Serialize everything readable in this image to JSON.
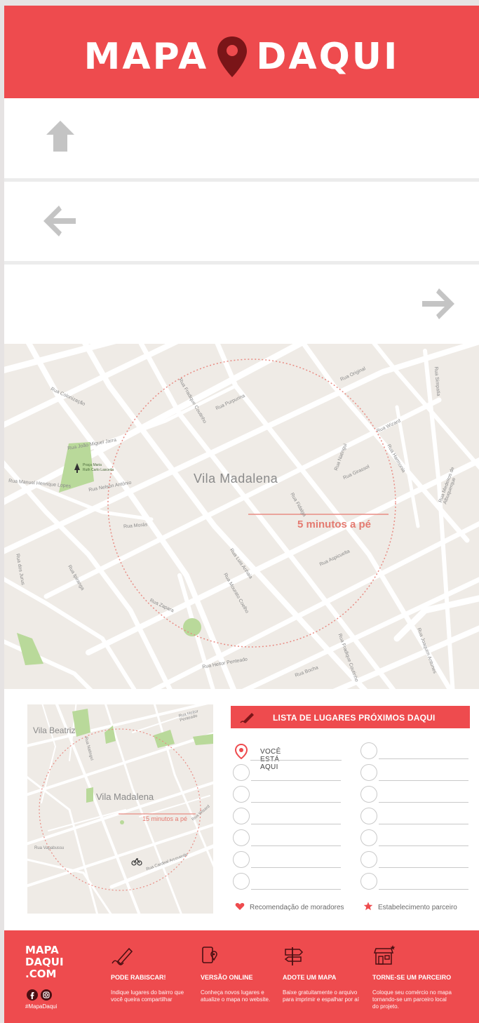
{
  "header": {
    "brand_left": "MAPA",
    "brand_right": "DAQUI"
  },
  "directions": [
    {
      "icon": "arrow-up-icon"
    },
    {
      "icon": "arrow-left-icon"
    },
    {
      "icon": "arrow-right-icon"
    }
  ],
  "main_map": {
    "neighborhood": "Vila Madalena",
    "radius_label": "5 minutos a pé",
    "park_label_1": "Praça Maria",
    "park_label_2": "Ruth Carlo Lasceda",
    "streets": [
      "Rua Purpurina",
      "Rua Girassol",
      "Rua Original",
      "Rua Wizard",
      "Rua Fradique Coutinho",
      "Rua Mourato Coelho",
      "Rua Luis Anhaia",
      "Rua Aspicuelta",
      "Rua Morás",
      "Rua Harmonia",
      "Rua Fidalga",
      "Rua Simpatia",
      "Rua Medeiros de Albuquerque",
      "Rua Natingui",
      "Rua João Miguel Jarra",
      "Rua Nelson Antônio",
      "Rua Manuel Henrique Lopes",
      "Rua Colonização",
      "Rua Ipiranga",
      "Rua dos Jurus",
      "Rua Zapara",
      "Rua Heitor Penteado",
      "Rua Bocha",
      "Rua Fradique Coutinho",
      "Rua Joaquim Antunes"
    ]
  },
  "small_map": {
    "area_top": "Vila Beatriz",
    "neighborhood": "Vila Madalena",
    "radius_label": "15 minutos a pé",
    "streets": [
      "Rua Natingui",
      "Rua Cardeal Arcoverde",
      "Rua Heitor Penteado",
      "Rua Wisard",
      "Rua Vapabussu"
    ]
  },
  "places_list": {
    "title": "LISTA DE LUGARES PRÓXIMOS DAQUI",
    "you_are_here": "VOCÊ ESTÁ AQUI",
    "legend_resident": "Recomendação de moradores",
    "legend_partner": "Estabelecimento parceiro"
  },
  "footer": {
    "logo_lines": [
      "MAPA",
      "DAQUI",
      ".COM"
    ],
    "hashtag": "#MapaDaqui",
    "columns": [
      {
        "icon": "pencil-icon",
        "title": "PODE RABISCAR!",
        "desc": "Indique lugares do bairro que você queira compartilhar"
      },
      {
        "icon": "phone-map-icon",
        "title": "VERSÃO ONLINE",
        "desc": "Conheça novos lugares e atualize o mapa no website."
      },
      {
        "icon": "signpost-icon",
        "title": "ADOTE UM MAPA",
        "desc": "Baixe gratuitamente o arquivo para imprimir e espalhar por aí"
      },
      {
        "icon": "storefront-icon",
        "title": "TORNE-SE UM PARCEIRO",
        "desc": "Coloque seu comércio no mapa tornando-se um parceiro local do projeto."
      }
    ]
  },
  "colors": {
    "brand_red": "#ee4b4e",
    "map_bg": "#efebe6",
    "park_green": "#b9d99a",
    "arrow_gray": "#c4c4c4"
  }
}
